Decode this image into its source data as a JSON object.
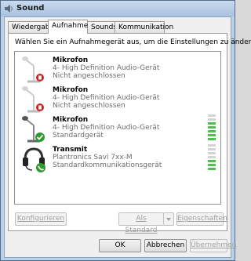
{
  "window": {
    "title": "Sound"
  },
  "tabs": [
    {
      "label": "Wiedergabe",
      "active": false
    },
    {
      "label": "Aufnahme",
      "active": true
    },
    {
      "label": "Sounds",
      "active": false
    },
    {
      "label": "Kommunikation",
      "active": false
    }
  ],
  "instruction": "Wählen Sie ein Aufnahmegerät aus, um die Einstellungen zu ändern:",
  "devices": [
    {
      "name": "Mikrofon",
      "description": "4- High Definition Audio-Gerät",
      "status": "Nicht angeschlossen",
      "icon": "microphone-icon",
      "badge": "disconnected-badge",
      "level": null
    },
    {
      "name": "Mikrofon",
      "description": "4- High Definition Audio-Gerät",
      "status": "Nicht angeschlossen",
      "icon": "microphone-icon",
      "badge": "disconnected-badge",
      "level": null
    },
    {
      "name": "Mikrofon",
      "description": "4- High Definition Audio-Gerät",
      "status": "Standardgerät",
      "icon": "microphone-icon",
      "badge": "default-check-badge",
      "level_segments_on": 5,
      "level_segments_total": 7
    },
    {
      "name": "Transmit",
      "description": "Plantronics Savi 7xx-M",
      "status": "Standardkommunikationsgerät",
      "icon": "headset-icon",
      "badge": "communication-phone-badge",
      "level_segments_on": 3,
      "level_segments_total": 7
    }
  ],
  "buttons": {
    "configure": "Konfigurieren",
    "set_default": "Als Standard",
    "properties": "Eigenschaften",
    "ok": "OK",
    "cancel": "Abbrechen",
    "apply": "Übernehmen"
  },
  "colors": {
    "level_on": "#4ec24a",
    "level_off": "#d4d4d4",
    "disconnected": "#d22020",
    "default_check": "#2f9a2f"
  }
}
